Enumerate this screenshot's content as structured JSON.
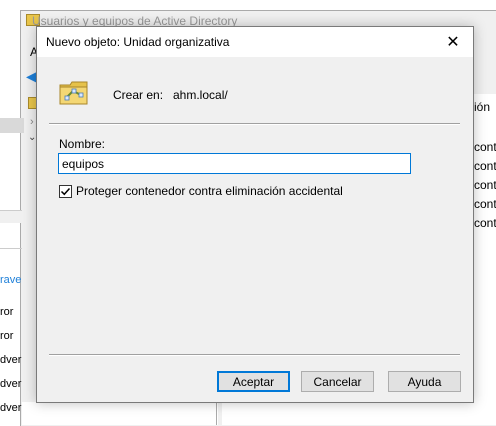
{
  "background_window": {
    "title": "Usuarios y equipos de Active Directory",
    "menu_first": "A",
    "right_col_header": "ión",
    "right_col_items": [
      "conta",
      "conta",
      "conta",
      "conta",
      "conta"
    ],
    "left_items": [
      "rave",
      "ror",
      "ror",
      "dver",
      "dver",
      "dver"
    ]
  },
  "dialog": {
    "title": "Nuevo objeto: Unidad organizativa",
    "create_in_label": "Crear en:",
    "create_in_path": "ahm.local/",
    "name_label": "Nombre:",
    "name_value": "equipos",
    "protect_label": "Proteger contenedor contra eliminación accidental",
    "protect_checked": true,
    "buttons": {
      "ok": "Aceptar",
      "cancel": "Cancelar",
      "help": "Ayuda"
    }
  },
  "colors": {
    "focus_border": "#0078d7",
    "dialog_bg": "#f0f0f0",
    "link_blue": "#1e7fd8"
  }
}
